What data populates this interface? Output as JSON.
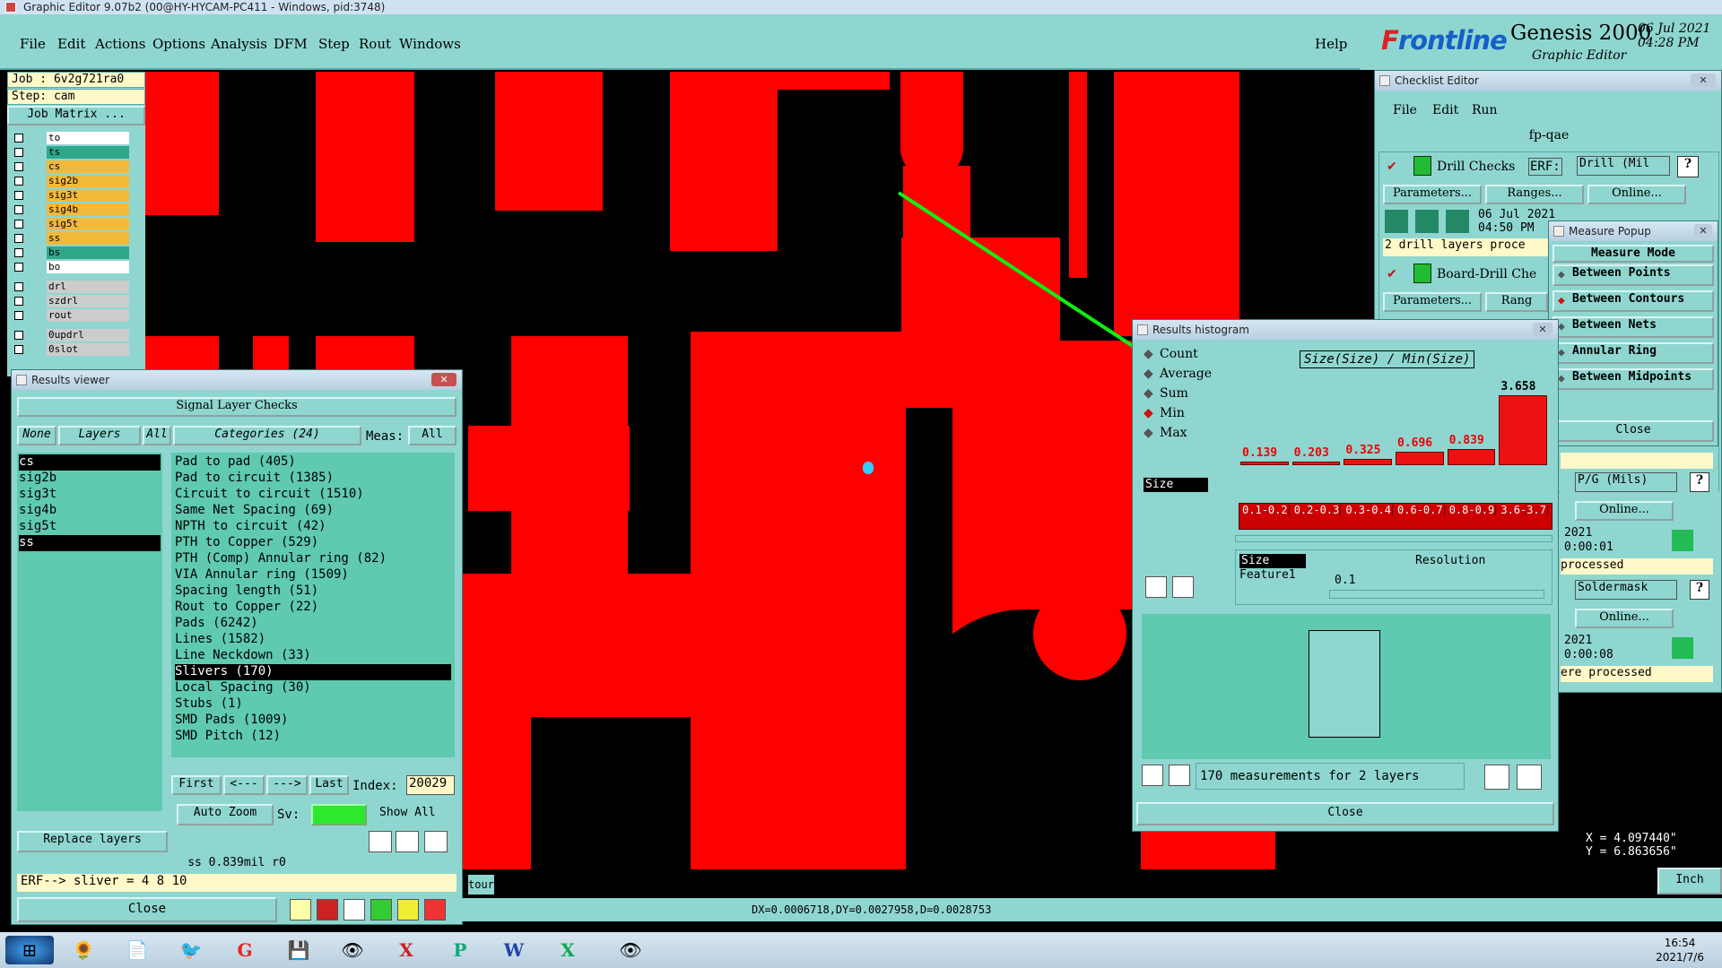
{
  "window_title": "Graphic Editor 9.07b2 (00@HY-HYCAM-PC411 - Windows, pid:3748)",
  "menu": [
    "File",
    "Edit",
    "Actions",
    "Options",
    "Analysis",
    "DFM",
    "Step",
    "Rout",
    "Windows"
  ],
  "help": "Help",
  "brand": {
    "logo_a": "F",
    "logo_b": "rontline",
    "product": "Genesis 2000",
    "subtitle": "Graphic Editor",
    "date": "06 Jul 2021",
    "time": "04:28 PM"
  },
  "job": {
    "job": "Job : 6v2g721ra0",
    "step": "Step: cam",
    "matrix_btn": "Job Matrix ..."
  },
  "layers": [
    {
      "name": "to",
      "color": "#ffffff"
    },
    {
      "name": "ts",
      "color": "#2fa88a"
    },
    {
      "name": "cs",
      "color": "#f2b93a"
    },
    {
      "name": "sig2b",
      "color": "#f2b93a"
    },
    {
      "name": "sig3t",
      "color": "#f2b93a"
    },
    {
      "name": "sig4b",
      "color": "#f2b93a"
    },
    {
      "name": "sig5t",
      "color": "#f2b93a"
    },
    {
      "name": "ss",
      "color": "#f2b93a"
    },
    {
      "name": "bs",
      "color": "#2fa88a"
    },
    {
      "name": "bo",
      "color": "#ffffff"
    }
  ],
  "layers2": [
    {
      "name": "drl"
    },
    {
      "name": "szdrl"
    },
    {
      "name": "rout"
    }
  ],
  "layers3": [
    {
      "name": "0updrl"
    },
    {
      "name": "0slot"
    }
  ],
  "results_viewer": {
    "title": "Results viewer",
    "heading": "Signal Layer Checks",
    "none": "None",
    "layers": "Layers",
    "all": "All",
    "categories": "Categories (24)",
    "meas": "Meas:",
    "meas_val": "All",
    "layer_list": [
      "cs",
      "sig2b",
      "sig3t",
      "sig4b",
      "sig5t",
      "ss"
    ],
    "cat_list": [
      "Pad to pad (405)",
      "Pad to circuit (1385)",
      "Circuit to circuit (1510)",
      "Same Net Spacing (69)",
      "NPTH to circuit (42)",
      "PTH to Copper (529)",
      "PTH (Comp) Annular ring (82)",
      "VIA Annular ring (1509)",
      "Spacing length (51)",
      "Rout to Copper (22)",
      "Pads (6242)",
      "Lines (1582)",
      "Line Neckdown (33)",
      "Slivers (170)",
      "Local Spacing (30)",
      "Stubs (1)",
      "SMD Pads (1009)",
      "SMD Pitch (12)"
    ],
    "first": "First",
    "prev": "<---",
    "next": "--->",
    "last": "Last",
    "index_lbl": "Index:",
    "index_val": "20029",
    "autozoom": "Auto Zoom",
    "sv": "Sv:",
    "showall": "Show All",
    "replace": "Replace layers",
    "info": "ss 0.839mil  r0",
    "erf": "ERF--> sliver = 4 8 10",
    "close": "Close"
  },
  "checklist": {
    "title": "Checklist Editor",
    "menu": [
      "File",
      "Edit",
      "Run"
    ],
    "name": "fp-qae",
    "drill_checks": "Drill Checks",
    "erf": "ERF:",
    "erf_val": "Drill (Mil",
    "params": "Parameters...",
    "ranges": "Ranges...",
    "online": "Online...",
    "date": "06 Jul 2021",
    "time": "04:50 PM",
    "status": "2 drill layers proce",
    "board_drill": "Board-Drill Che",
    "rang": "Rang",
    "pg": "P/G (Mils)",
    "t1": "2021",
    "t1b": "0:00:01",
    "processed": " processed",
    "soldermask": "Soldermask",
    "t2": "2021",
    "t2b": "0:00:08",
    "ere": "ere processed"
  },
  "measure": {
    "title": "Measure Popup",
    "mode": "Measure Mode",
    "options": [
      "Between Points",
      "Between Contours",
      "Between Nets",
      "Annular Ring",
      "Between Midpoints"
    ],
    "close": "Close"
  },
  "histogram": {
    "title": "Results histogram",
    "options": [
      "Count",
      "Average",
      "Sum",
      "Min",
      "Max"
    ],
    "field": "Size",
    "chart_title": "Size(Size) / Min(Size)",
    "res_lbl1": "Size",
    "res_lbl2": "Feature1",
    "resolution": "Resolution",
    "res_val": "0.1",
    "summary": "170 measurements for 2 layers",
    "close": "Close"
  },
  "chart_data": {
    "type": "bar",
    "title": "Size(Size) / Min(Size)",
    "categories": [
      "0.1-0.2",
      "0.2-0.3",
      "0.3-0.4",
      "0.6-0.7",
      "0.8-0.9",
      "3.6-3.7"
    ],
    "values": [
      0.139,
      0.203,
      0.325,
      0.696,
      0.839,
      3.658
    ]
  },
  "statusbar": {
    "tour": "tour",
    "delta": "DX=0.0006718,DY=0.0027958,D=0.0028753",
    "unit": "Inch"
  },
  "coords": {
    "x": "X = 4.097440\"",
    "y": "Y = 6.863656\""
  },
  "tray": {
    "time": "16:54",
    "date": "2021/7/6"
  }
}
